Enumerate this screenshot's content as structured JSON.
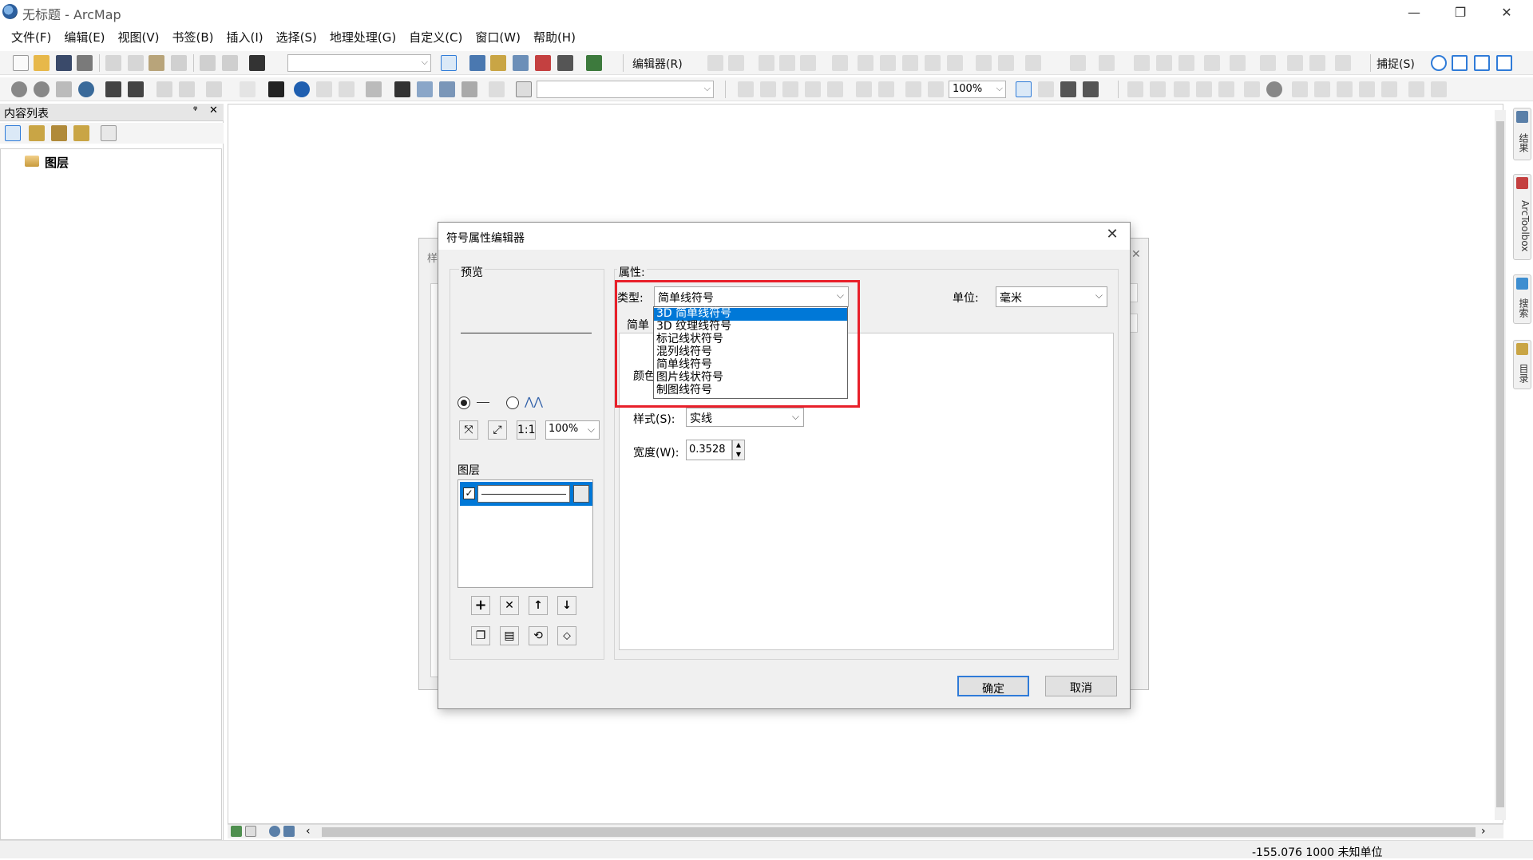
{
  "window": {
    "title": "无标题 - ArcMap",
    "minimize": "—",
    "restore": "❐",
    "close": "✕"
  },
  "menu": [
    "文件(F)",
    "编辑(E)",
    "视图(V)",
    "书签(B)",
    "插入(I)",
    "选择(S)",
    "地理处理(G)",
    "自定义(C)",
    "窗口(W)",
    "帮助(H)"
  ],
  "toolbar1": {
    "editor_label": "编辑器(R)",
    "snap_label": "捕捉(S)"
  },
  "toolbar2": {
    "zoom_value": "100%"
  },
  "toc": {
    "title": "内容列表",
    "pin": "ᵠ",
    "close": "✕",
    "layer_root": "图层"
  },
  "dock_tabs": [
    "结果",
    "ArcToolbox",
    "搜索",
    "目录"
  ],
  "status": {
    "coords": "-155.076  1000 未知单位"
  },
  "background_dialog": {
    "title_fragment": "样"
  },
  "dialog": {
    "title": "符号属性编辑器",
    "close": "✕",
    "preview_label": "预览",
    "layers_label": "图层",
    "zoom_value": "100%",
    "properties_label": "属性:",
    "type_label": "类型:",
    "type_value": "简单线符号",
    "unit_label": "单位:",
    "unit_value": "毫米",
    "tab_fragment": "简单",
    "color_fragment": "颜色",
    "style_label": "样式(S):",
    "style_value": "实线",
    "width_label": "宽度(W):",
    "width_value": "0.3528",
    "ok": "确定",
    "cancel": "取消",
    "type_options": [
      "3D 简单线符号",
      "3D 纹理线符号",
      "标记线状符号",
      "混列线符号",
      "简单线符号",
      "图片线状符号",
      "制图线符号"
    ],
    "selected_option_index": 0
  },
  "colors": {
    "highlight": "#e8202a",
    "selection": "#0078d7",
    "primary_border": "#2f7bd8"
  }
}
